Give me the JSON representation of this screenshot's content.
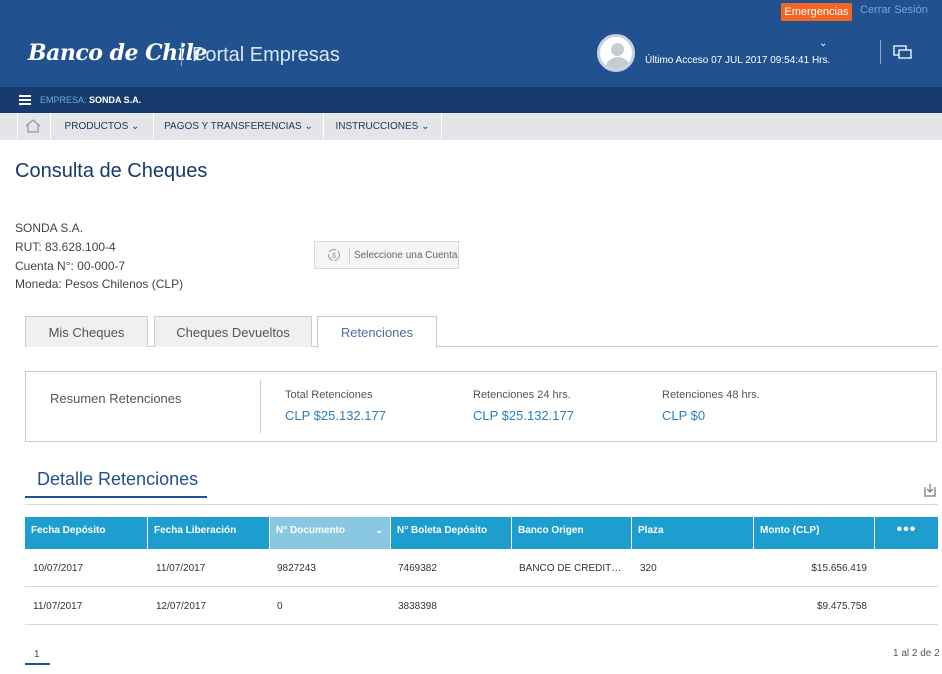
{
  "header": {
    "emergency_label": "Emergencias",
    "logout_label": "Cerrar Sesión",
    "brand": "Banco de Chile",
    "portal_name": "Portal Empresas",
    "last_access": "Último Acceso 07 JUL 2017 09:54:41 Hrs."
  },
  "company_bar": {
    "label": "EMPRESA:",
    "name": "SONDA S.A."
  },
  "nav": {
    "items": [
      {
        "label": "PRODUCTOS"
      },
      {
        "label": "PAGOS Y TRANSFERENCIAS"
      },
      {
        "label": "INSTRUCCIONES"
      }
    ]
  },
  "page": {
    "title": "Consulta de Cheques",
    "company": "SONDA S.A.",
    "rut": "RUT: 83.628.100-4",
    "account": "Cuenta N°: 00-000-7",
    "currency": "Moneda: Pesos Chilenos (CLP)",
    "select_account_label": "Seleccione una Cuenta"
  },
  "tabs": [
    {
      "label": "Mis Cheques"
    },
    {
      "label": "Cheques Devueltos"
    },
    {
      "label": "Retenciones"
    }
  ],
  "summary": {
    "title": "Resumen Retenciones",
    "items": [
      {
        "label": "Total Retenciones",
        "value": "CLP $25.132.177"
      },
      {
        "label": "Retenciones 24 hrs.",
        "value": "CLP $25.132.177"
      },
      {
        "label": "Retenciones 48 hrs.",
        "value": "CLP $0"
      }
    ]
  },
  "detail": {
    "title": "Detalle Retenciones",
    "columns": [
      "Fecha Depósito",
      "Fecha Liberación",
      "N° Documento",
      "N° Boleta Depósito",
      "Banco Origen",
      "Plaza",
      "Monto (CLP)"
    ],
    "more_label": "•••",
    "rows": [
      {
        "deposit_date": "10/07/2017",
        "release_date": "11/07/2017",
        "document": "9827243",
        "slip": "7469382",
        "bank": "BANCO DE CREDIT…",
        "plaza": "320",
        "amount": "$15.656.419"
      },
      {
        "deposit_date": "11/07/2017",
        "release_date": "12/07/2017",
        "document": "0",
        "slip": "3838398",
        "bank": "",
        "plaza": "",
        "amount": "$9.475.758"
      }
    ]
  },
  "pagination": {
    "current": "1",
    "info": "1 al 2 de 2"
  },
  "colors": {
    "header_bg": "#22518f",
    "company_bar_bg": "#163b6c",
    "emergency_bg": "#f26522",
    "table_header_bg": "#1d9ecf",
    "link_blue": "#2a7fc0"
  }
}
